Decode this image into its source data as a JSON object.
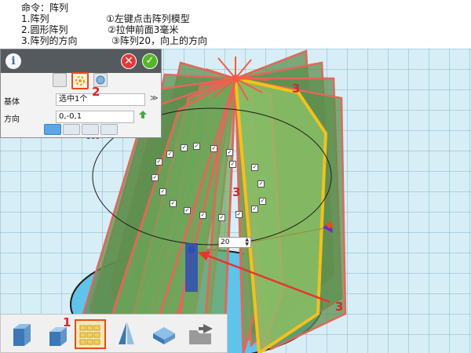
{
  "instructions": {
    "command": "命令：阵列",
    "left_steps": [
      "1.阵列",
      "2.圆形阵列",
      "3.阵列的方向"
    ],
    "right_steps": [
      "①左键点击阵列模型",
      "②拉伸前面3毫米",
      "③阵列20，向上的方向"
    ]
  },
  "panel": {
    "info_icon": "i",
    "close_icon": "✕",
    "ok_icon": "✓",
    "base_label": "基体",
    "base_value": "选中1个",
    "direction_label": "方向",
    "direction_value": "0,-0,1"
  },
  "viewport": {
    "count_value": "20",
    "axis_label": "360"
  },
  "toolbar": {
    "icons": [
      "extrude-icon",
      "shell-icon",
      "linear-array-icon",
      "mirror-icon",
      "move-icon",
      "export-icon"
    ]
  },
  "callouts": [
    "2",
    "3",
    "3",
    "1",
    "3"
  ],
  "colors": {
    "accent": "#e84c1a",
    "callout": "#d7262b",
    "fin": "#6fa65a",
    "fin_edge": "#e0685a",
    "highlight": "#f2c21a"
  }
}
